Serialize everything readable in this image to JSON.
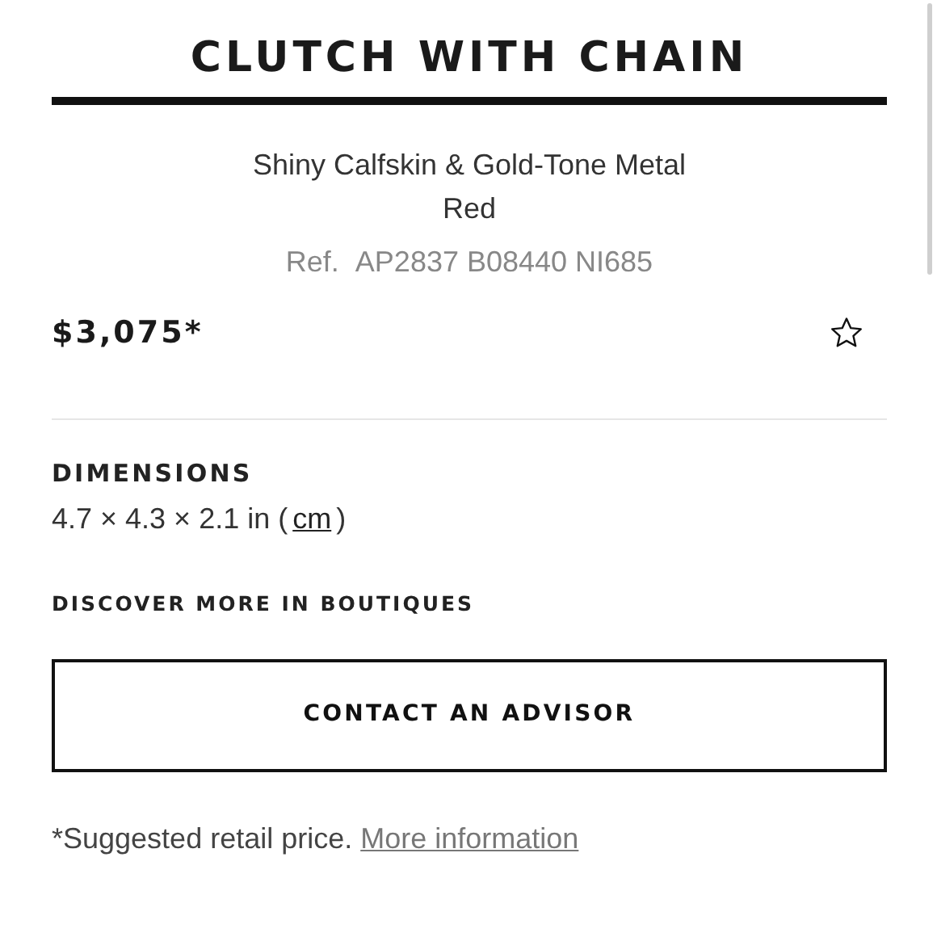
{
  "title": "CLUTCH WITH CHAIN",
  "material": "Shiny Calfskin & Gold-Tone Metal",
  "color_name": "Red",
  "reference": {
    "label": "Ref.",
    "code": "AP2837 B08440 NI685"
  },
  "price": "$3,075*",
  "favorite": {
    "on": false
  },
  "dimensions": {
    "heading": "DIMENSIONS",
    "value": "4.7 × 4.3 × 2.1 in (",
    "unit_link": "cm",
    "close": ")"
  },
  "boutiques_heading": "DISCOVER MORE IN BOUTIQUES",
  "contact_button": "CONTACT AN ADVISOR",
  "footnote": {
    "text": "*Suggested retail price.",
    "link": "More information"
  }
}
